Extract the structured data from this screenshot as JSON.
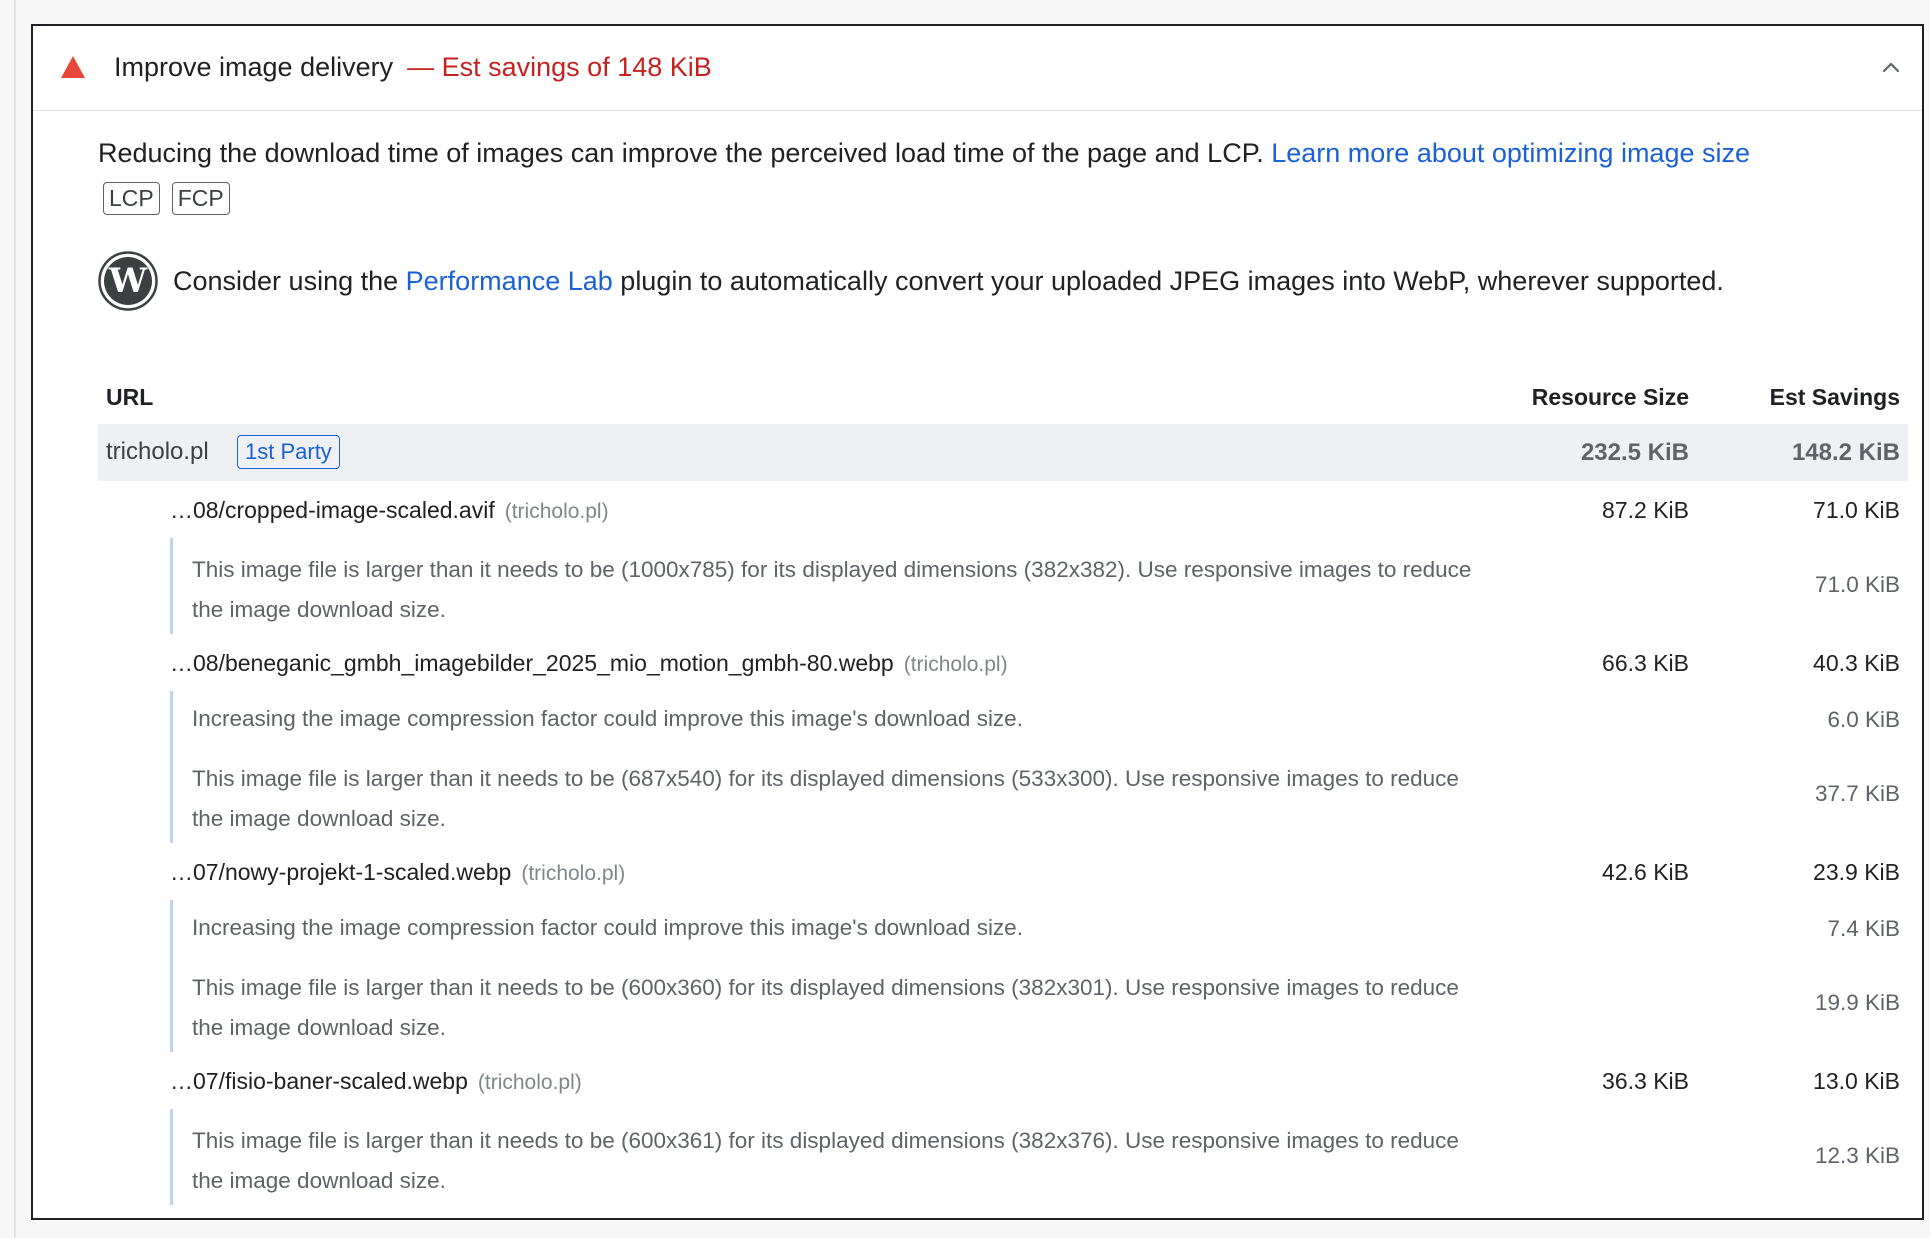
{
  "audit": {
    "title": "Improve image delivery",
    "savings": "— Est savings of 148 KiB",
    "status": "fail",
    "colors": {
      "warning": "#e8463a",
      "savings": "#c5221f",
      "link": "#1a61d8"
    }
  },
  "description": {
    "text": "Reducing the download time of images can improve the perceived load time of the page and LCP.",
    "link": "Learn more about optimizing image size"
  },
  "tags": [
    "LCP",
    "FCP"
  ],
  "plugin": {
    "prefix": "Consider using the",
    "link": "Performance Lab",
    "suffix": "plugin to automatically convert your uploaded JPEG images into WebP, wherever supported.",
    "icon": "wordpress-icon"
  },
  "table": {
    "headers": {
      "url": "URL",
      "size": "Resource Size",
      "savings": "Est Savings"
    },
    "group": {
      "name": "tricholo.pl",
      "badge": "1st Party",
      "size": "232.5 KiB",
      "savings": "148.2 KiB"
    },
    "items": [
      {
        "url": "…08/cropped-image-scaled.avif",
        "origin": "(tricholo.pl)",
        "size": "87.2 KiB",
        "savings": "71.0 KiB",
        "subs": [
          {
            "text": "This image file is larger than it needs to be (1000x785) for its displayed dimensions (382x382). Use responsive images to reduce the image download size.",
            "savings": "71.0 KiB"
          }
        ]
      },
      {
        "url": "…08/beneganic_gmbh_imagebilder_2025_mio_motion_gmbh-80.webp",
        "origin": "(tricholo.pl)",
        "size": "66.3 KiB",
        "savings": "40.3 KiB",
        "subs": [
          {
            "text": "Increasing the image compression factor could improve this image's download size.",
            "savings": "6.0 KiB"
          },
          {
            "text": "This image file is larger than it needs to be (687x540) for its displayed dimensions (533x300). Use responsive images to reduce the image download size.",
            "savings": "37.7 KiB"
          }
        ]
      },
      {
        "url": "…07/nowy-projekt-1-scaled.webp",
        "origin": "(tricholo.pl)",
        "size": "42.6 KiB",
        "savings": "23.9 KiB",
        "subs": [
          {
            "text": "Increasing the image compression factor could improve this image's download size.",
            "savings": "7.4 KiB"
          },
          {
            "text": "This image file is larger than it needs to be (600x360) for its displayed dimensions (382x301). Use responsive images to reduce the image download size.",
            "savings": "19.9 KiB"
          }
        ]
      },
      {
        "url": "…07/fisio-baner-scaled.webp",
        "origin": "(tricholo.pl)",
        "size": "36.3 KiB",
        "savings": "13.0 KiB",
        "subs": [
          {
            "text": "This image file is larger than it needs to be (600x361) for its displayed dimensions (382x376). Use responsive images to reduce the image download size.",
            "savings": "12.3 KiB"
          }
        ]
      }
    ]
  }
}
